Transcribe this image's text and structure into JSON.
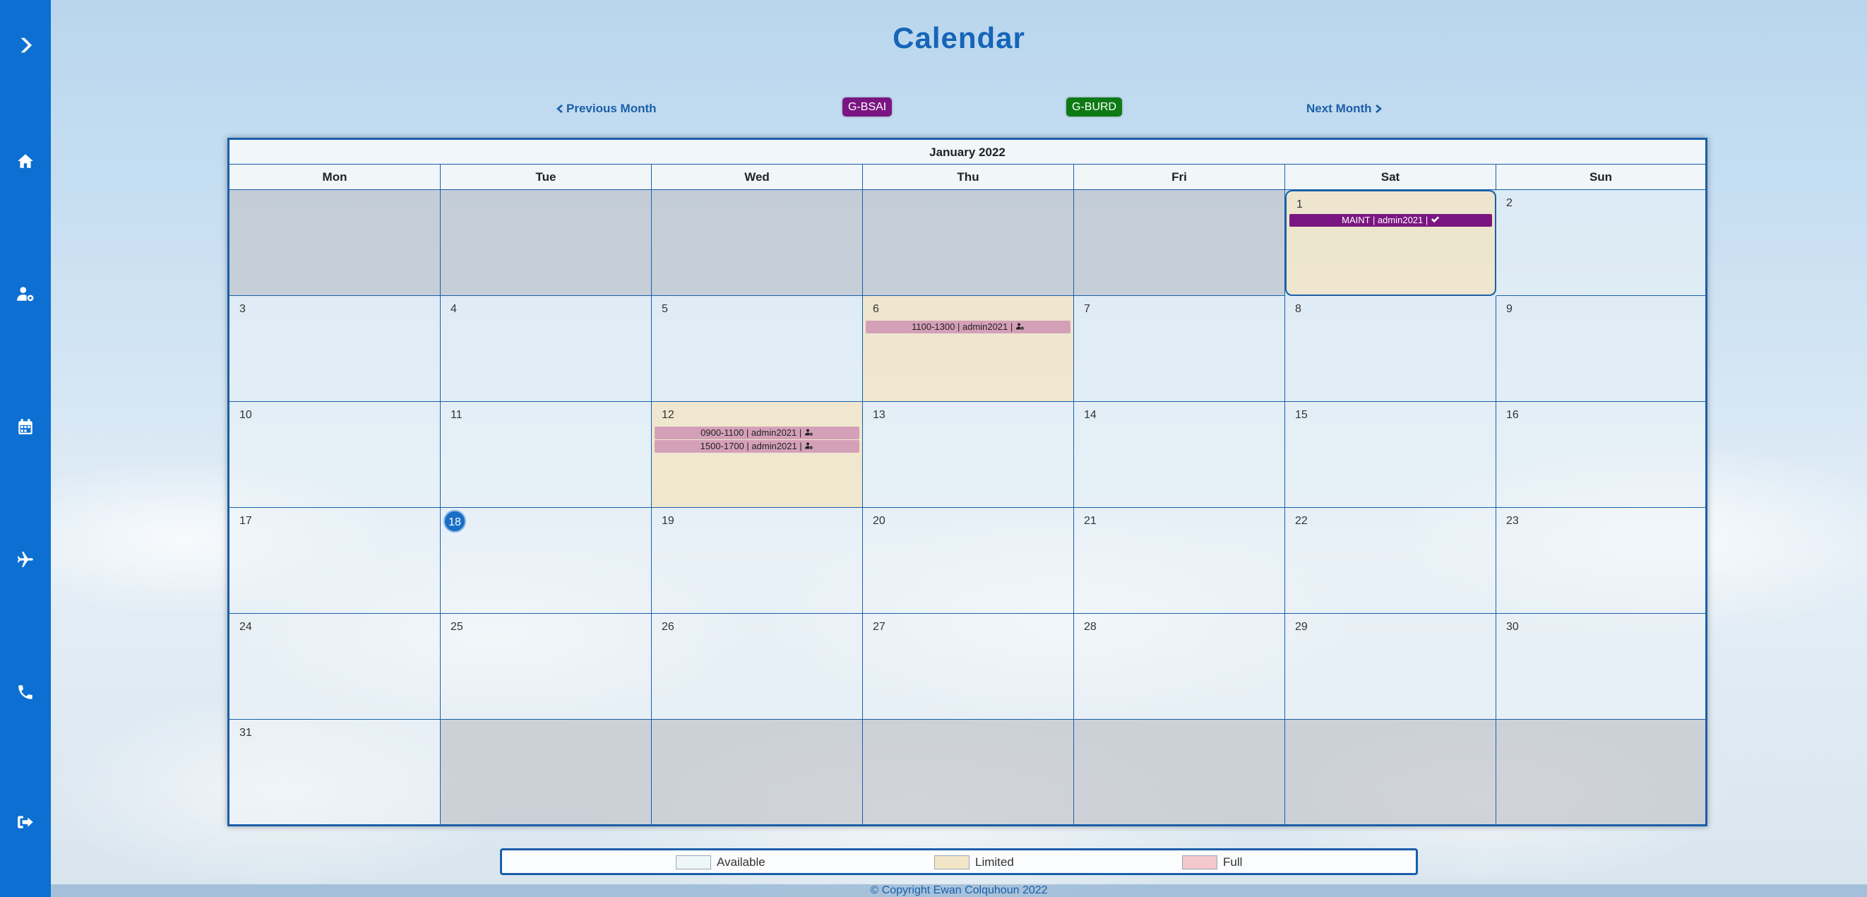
{
  "app": {
    "title": "Calendar"
  },
  "nav": {
    "prev_label": "Previous Month",
    "next_label": "Next Month"
  },
  "aircraft": [
    {
      "label": "G-BSAI",
      "color": "#7a1681"
    },
    {
      "label": "G-BURD",
      "color": "#0e7a14"
    }
  ],
  "sidebar": {
    "items": [
      {
        "icon": "chevron-right-icon"
      },
      {
        "icon": "home-icon"
      },
      {
        "icon": "user-cog-icon"
      },
      {
        "icon": "calendar-icon"
      },
      {
        "icon": "plane-icon"
      },
      {
        "icon": "phone-icon"
      },
      {
        "icon": "sign-out-icon"
      }
    ],
    "color": "#0c6fd1"
  },
  "calendar": {
    "month_label": "January 2022",
    "weekdays": [
      "Mon",
      "Tue",
      "Wed",
      "Thu",
      "Fri",
      "Sat",
      "Sun"
    ],
    "today": "18",
    "selected_day": "1",
    "days": {
      "d1": "1",
      "d2": "2",
      "d3": "3",
      "d4": "4",
      "d5": "5",
      "d6": "6",
      "d7": "7",
      "d8": "8",
      "d9": "9",
      "d10": "10",
      "d11": "11",
      "d12": "12",
      "d13": "13",
      "d14": "14",
      "d15": "15",
      "d16": "16",
      "d17": "17",
      "d18": "18",
      "d19": "19",
      "d20": "20",
      "d21": "21",
      "d22": "22",
      "d23": "23",
      "d24": "24",
      "d25": "25",
      "d26": "26",
      "d27": "27",
      "d28": "28",
      "d29": "29",
      "d30": "30",
      "d31": "31"
    },
    "events": {
      "jan1": {
        "text": "MAINT | admin2021 | ",
        "icon": "check-icon",
        "status_color": "#7a1681"
      },
      "jan6": {
        "text": "1100-1300 | admin2021 | ",
        "icon": "user-cog-icon"
      },
      "jan12a": {
        "text": "0900-1100 | admin2021 | ",
        "icon": "user-cog-icon"
      },
      "jan12b": {
        "text": "1500-1700 | admin2021 | ",
        "icon": "user-cog-icon"
      }
    }
  },
  "legend": {
    "available": "Available",
    "limited": "Limited",
    "full": "Full",
    "colors": {
      "available": "#eef6f6",
      "limited": "#f3e6c8",
      "full": "#f4c8cc"
    }
  },
  "footer": {
    "copyright": "© Copyright Ewan Colquhoun 2022"
  }
}
